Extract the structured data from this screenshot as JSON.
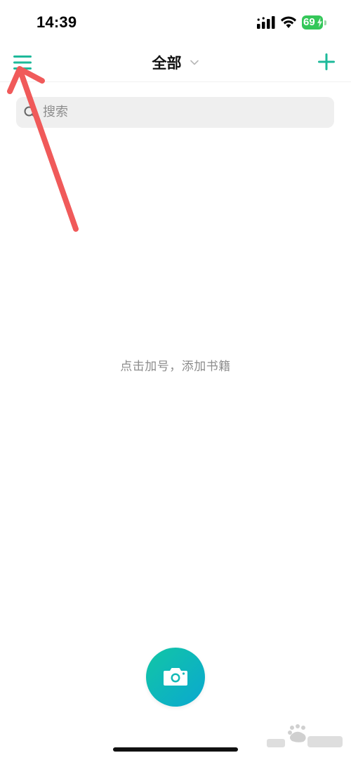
{
  "status_bar": {
    "time": "14:39",
    "battery_level": "69",
    "battery_color": "#34c759"
  },
  "nav": {
    "title": "全部",
    "menu_icon": "hamburger-menu-icon",
    "add_icon": "plus-icon",
    "accent_color": "#1db99a"
  },
  "search": {
    "placeholder": "搜索",
    "icon": "search-icon"
  },
  "empty_state": {
    "hint": "点击加号，添加书籍"
  },
  "camera": {
    "icon": "camera-icon"
  },
  "annotation": {
    "color": "#f05a5a",
    "target": "menu-button"
  }
}
